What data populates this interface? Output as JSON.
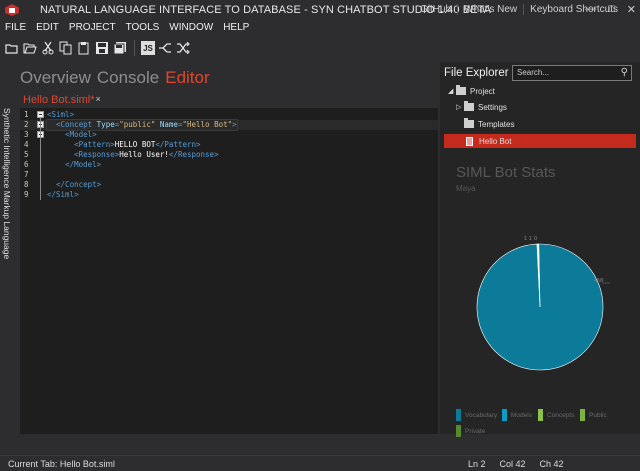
{
  "title_bar": {
    "title": "NATURAL LANGUAGE INTERFACE TO DATABASE - SYN CHATBOT STUDIO 1.40 BETA",
    "links": [
      "GitHub",
      "What's New",
      "Keyboard Shortcuts"
    ],
    "controls": {
      "minimize": "—",
      "maximize": "□",
      "close": "✕"
    }
  },
  "menu": [
    "FILE",
    "EDIT",
    "PROJECT",
    "TOOLS",
    "WINDOW",
    "HELP"
  ],
  "toolbar": {
    "js_label": "JS",
    "icons": [
      "open-folder-icon",
      "open-file-icon",
      "cut-icon",
      "copy-icon",
      "paste-icon",
      "save-icon",
      "save-all-icon",
      "js-icon",
      "split-icon",
      "shuffle-icon"
    ]
  },
  "side_label": "Synthetic Intelligence Markup Language",
  "tabs": {
    "items": [
      {
        "label": "Overview"
      },
      {
        "label": "Console"
      },
      {
        "label": "Editor"
      }
    ],
    "active": "Editor"
  },
  "document": {
    "tab_label": "Hello Bot.siml*",
    "close_glyph": "×"
  },
  "editor": {
    "lines": [
      {
        "num": "1",
        "fold": true,
        "indent": "",
        "parts": [
          [
            "tag",
            "<Siml>"
          ]
        ]
      },
      {
        "num": "2",
        "fold": true,
        "highlight": true,
        "indent": "  ",
        "parts": [
          [
            "tag",
            "<Concept "
          ],
          [
            "attr",
            "Type"
          ],
          [
            "tag",
            "="
          ],
          [
            "val",
            "\"public\""
          ],
          [
            "attr",
            " Name"
          ],
          [
            "tag",
            "="
          ],
          [
            "val",
            "\"Hello Bot\""
          ],
          [
            "tag",
            ">"
          ]
        ]
      },
      {
        "num": "3",
        "fold": true,
        "indent": "    ",
        "parts": [
          [
            "tag",
            "<Model>"
          ]
        ]
      },
      {
        "num": "4",
        "indent": "      ",
        "parts": [
          [
            "tag",
            "<Pattern>"
          ],
          [
            "txt",
            "HELLO BOT"
          ],
          [
            "tag",
            "</Pattern>"
          ]
        ]
      },
      {
        "num": "5",
        "indent": "      ",
        "parts": [
          [
            "tag",
            "<Response>"
          ],
          [
            "txt",
            "Hello User!"
          ],
          [
            "tag",
            "</Response>"
          ]
        ]
      },
      {
        "num": "6",
        "indent": "    ",
        "parts": [
          [
            "tag",
            "</Model>"
          ]
        ]
      },
      {
        "num": "7",
        "indent": "",
        "parts": []
      },
      {
        "num": "8",
        "indent": "  ",
        "parts": [
          [
            "tag",
            "</Concept>"
          ]
        ]
      },
      {
        "num": "9",
        "indent": "",
        "parts": [
          [
            "tag",
            "</Siml>"
          ]
        ]
      }
    ]
  },
  "explorer": {
    "title": "File Explorer",
    "search_placeholder": "Search...",
    "items": [
      {
        "label": "Project",
        "level": 0,
        "expanded": true
      },
      {
        "label": "Settings",
        "level": 1,
        "expanded": false
      },
      {
        "label": "Templates",
        "level": 1
      },
      {
        "label": "Hello Bot",
        "level": 1,
        "selected": true
      }
    ]
  },
  "stats": {
    "title": "SIML Bot Stats",
    "subtitle": "Maya"
  },
  "chart_data": {
    "type": "pie",
    "series": [
      {
        "name": "Vocabulary",
        "value": 0,
        "color": "#3b6ea5"
      },
      {
        "name": "Models",
        "value": 458,
        "color": "#0b7b99"
      },
      {
        "name": "Concepts",
        "value": 1,
        "color": "#5fa843"
      },
      {
        "name": "Public",
        "value": 1,
        "color": "#8fbf5f"
      },
      {
        "name": "Private",
        "value": 0,
        "color": "#4a7d2e"
      }
    ],
    "data_labels": [
      "458",
      "1",
      "1",
      "0"
    ],
    "legend_position": "bottom"
  },
  "status": {
    "current_tab": "Current Tab: Hello Bot.siml",
    "ln": "Ln 2",
    "col": "Col 42",
    "ch": "Ch 42"
  }
}
